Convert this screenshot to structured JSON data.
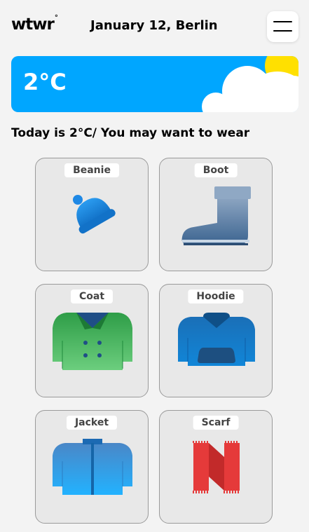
{
  "header": {
    "logo": "wtwr",
    "logo_degree": "°",
    "date_location": "January 12, Berlin"
  },
  "weather": {
    "temperature": "2°C",
    "condition": "cloudy-sunny"
  },
  "recommendation_text": "Today is 2°C/ You may want to wear",
  "items": [
    {
      "name": "Beanie",
      "icon": "beanie-icon"
    },
    {
      "name": "Boot",
      "icon": "boot-icon"
    },
    {
      "name": "Coat",
      "icon": "coat-icon"
    },
    {
      "name": "Hoodie",
      "icon": "hoodie-icon"
    },
    {
      "name": "Jacket",
      "icon": "jacket-icon"
    },
    {
      "name": "Scarf",
      "icon": "scarf-icon"
    }
  ],
  "colors": {
    "background": "#f3f3f3",
    "weather_card": "#00a6ff",
    "sun": "#ffe000",
    "card_bg": "#e8e8e8"
  }
}
